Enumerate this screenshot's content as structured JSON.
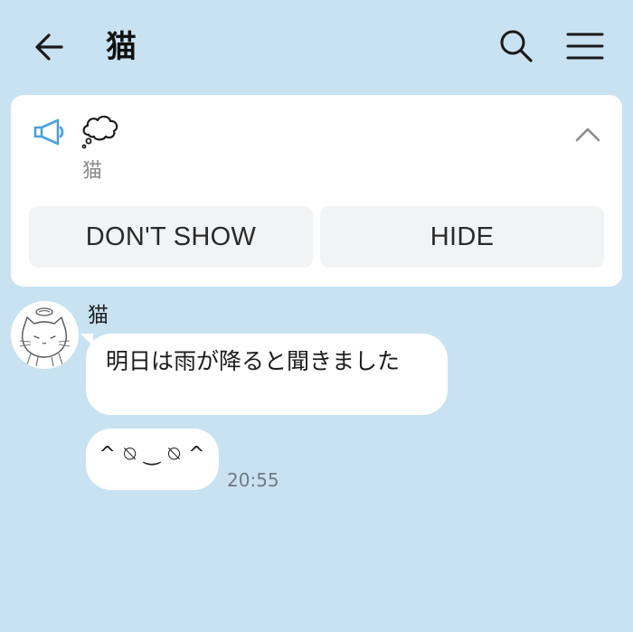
{
  "header": {
    "title": "猫",
    "icons": {
      "back": "arrow-left-icon",
      "search": "search-icon",
      "menu": "hamburger-menu-icon"
    }
  },
  "announcement": {
    "icons": {
      "megaphone": "megaphone-icon",
      "content": "thought-bubble-icon",
      "collapse": "chevron-up-icon"
    },
    "sender": "猫",
    "dont_show_label": "DON'T SHOW",
    "hide_label": "HIDE"
  },
  "messages": {
    "sender_name": "猫",
    "items": [
      {
        "text": "明日は雨が降ると聞きました"
      },
      {
        "text": "^ ⍉ ‿ ⍉ ^",
        "time": "20:55"
      }
    ]
  },
  "colors": {
    "background": "#c9e2f2",
    "card": "#ffffff",
    "button": "#f2f3f5",
    "accent": "#4b9fe0"
  }
}
